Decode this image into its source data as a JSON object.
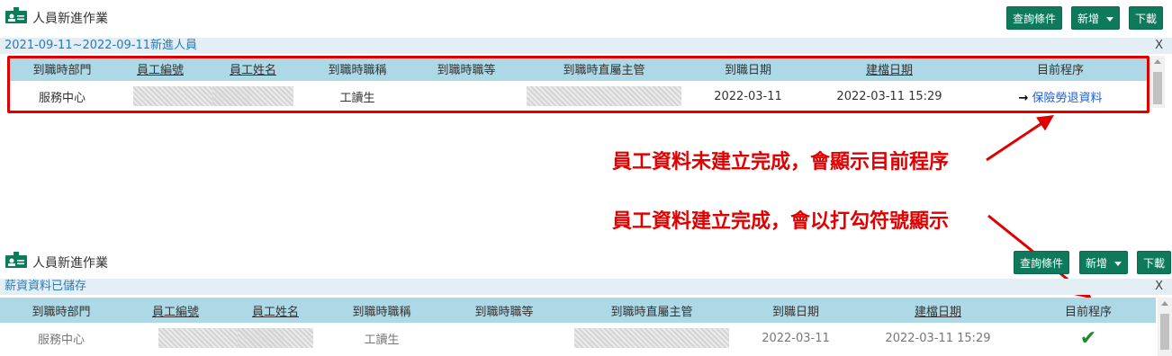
{
  "panel1": {
    "title": "人員新進作業",
    "buttons": {
      "query": "查詢條件",
      "add": "新增",
      "download": "下載"
    },
    "info_text": "2021-09-11~2022-09-11新進人員",
    "close_label": "X"
  },
  "panel2": {
    "title": "人員新進作業",
    "buttons": {
      "query": "查詢條件",
      "add": "新增",
      "download": "下載"
    },
    "info_text": "薪資資料已儲存",
    "close_label": "X"
  },
  "columns": [
    "到職時部門",
    "員工編號",
    "員工姓名",
    "到職時職稱",
    "到職時職等",
    "到職時直屬主管",
    "到職日期",
    "建檔日期",
    "目前程序"
  ],
  "row": {
    "department": "服務中心",
    "title": "工讀生",
    "start_date": "2022-03-11",
    "created": "2022-03-11 15:29",
    "process": "保險勞退資料",
    "process_arrow": "→"
  },
  "annotations": {
    "incomplete": "員工資料未建立完成，會顯示目前程序",
    "complete": "員工資料建立完成，會以打勾符號顯示"
  },
  "colors": {
    "header_bg": "#add8e6",
    "button_bg": "#0f7a5b",
    "annotation": "#e00000",
    "check": "#1a8a2e"
  }
}
